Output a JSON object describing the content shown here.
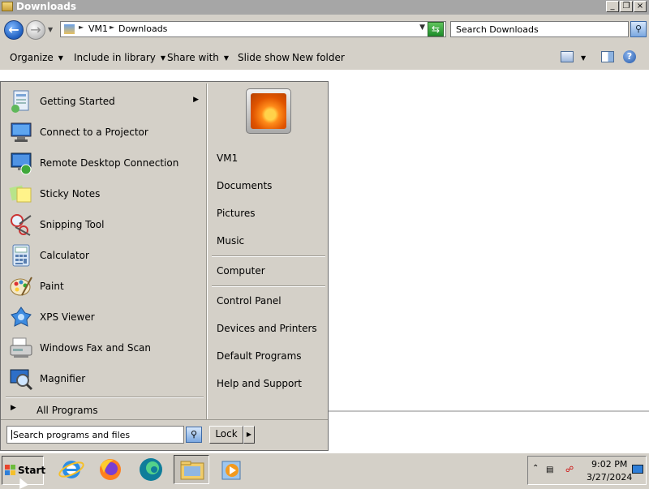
{
  "window": {
    "title": "Downloads",
    "controls": {
      "minimize": "_",
      "maximize": "❐",
      "close": "×"
    }
  },
  "address": {
    "crumbs": [
      "VM1",
      "Downloads"
    ],
    "search_placeholder": "Search Downloads"
  },
  "toolbar": {
    "organize": "Organize",
    "include_in_library": "Include in library",
    "share_with": "Share with",
    "slide_show": "Slide show",
    "new_folder": "New folder"
  },
  "start_menu": {
    "programs": [
      {
        "label": "Getting Started",
        "icon": "getting-started-icon",
        "has_submenu": true
      },
      {
        "label": "Connect to a Projector",
        "icon": "projector-icon"
      },
      {
        "label": "Remote Desktop Connection",
        "icon": "remote-desktop-icon"
      },
      {
        "label": "Sticky Notes",
        "icon": "sticky-notes-icon"
      },
      {
        "label": "Snipping Tool",
        "icon": "scissors-icon"
      },
      {
        "label": "Calculator",
        "icon": "calculator-icon"
      },
      {
        "label": "Paint",
        "icon": "paint-palette-icon"
      },
      {
        "label": "XPS Viewer",
        "icon": "xps-viewer-icon"
      },
      {
        "label": "Windows Fax and Scan",
        "icon": "fax-scanner-icon"
      },
      {
        "label": "Magnifier",
        "icon": "magnifier-icon"
      }
    ],
    "all_programs": "All Programs",
    "places": [
      {
        "label": "VM1"
      },
      {
        "label": "Documents"
      },
      {
        "label": "Pictures"
      },
      {
        "label": "Music"
      },
      {
        "label": "Computer"
      },
      {
        "label": "Control Panel"
      },
      {
        "label": "Devices and Printers"
      },
      {
        "label": "Default Programs"
      },
      {
        "label": "Help and Support"
      }
    ],
    "search_placeholder": "Search programs and files",
    "lock_label": "Lock"
  },
  "taskbar": {
    "start_label": "Start",
    "apps": [
      "internet-explorer-icon",
      "firefox-icon",
      "edge-icon",
      "file-explorer-icon",
      "media-player-icon"
    ],
    "clock_time": "9:02 PM",
    "clock_date": "3/27/2024"
  },
  "colors": {
    "window_face": "#d4d0c8",
    "titlebar": "#a6a6a6",
    "content": "#ffffff"
  }
}
